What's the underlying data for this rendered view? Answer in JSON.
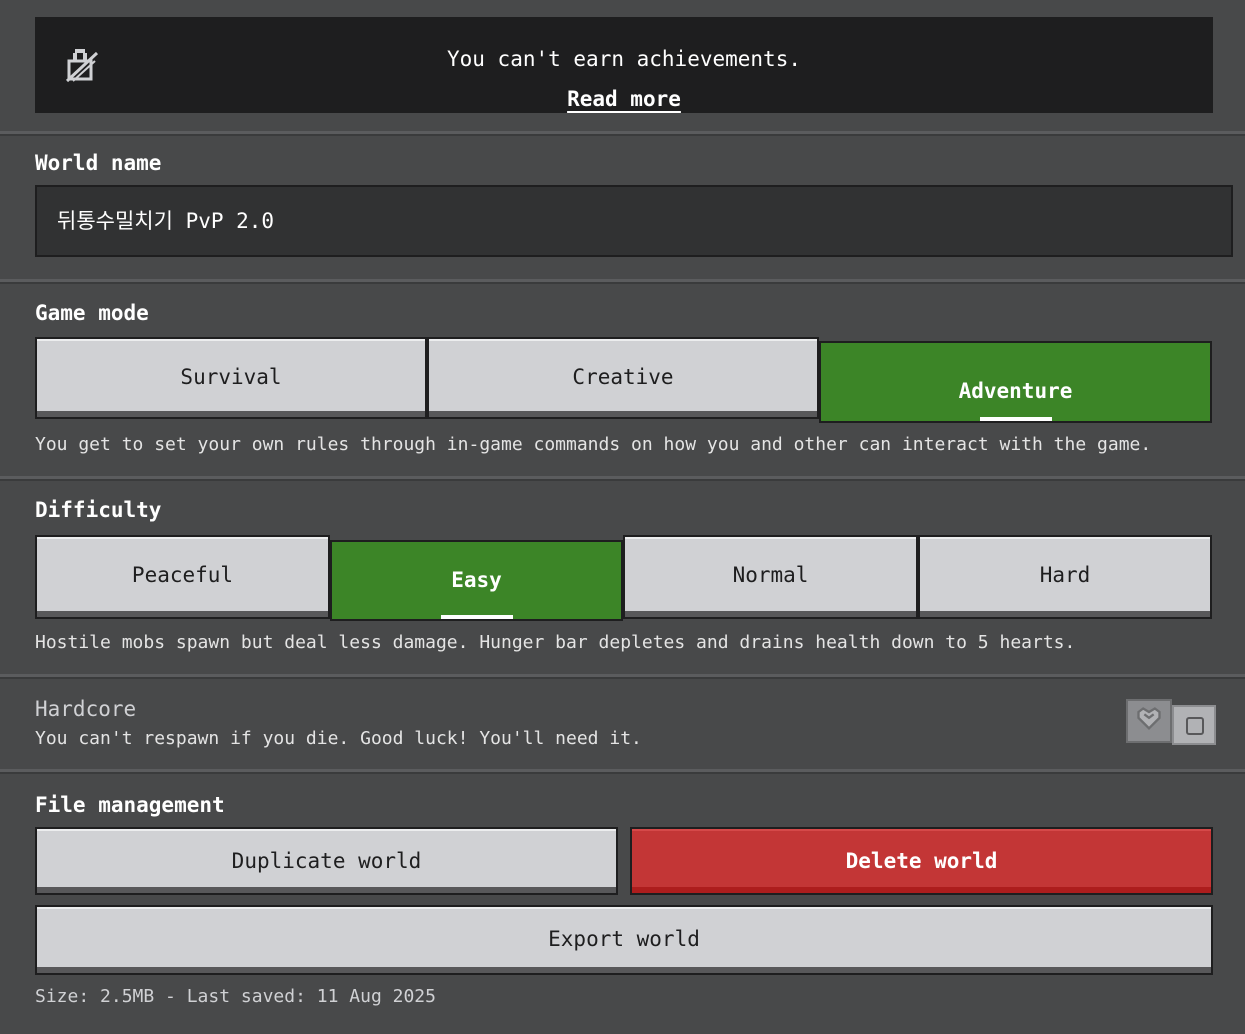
{
  "banner": {
    "message": "You can't earn achievements.",
    "link": "Read more",
    "icon": "lock-icon"
  },
  "world_name": {
    "label": "World name",
    "value": "뒤통수밀치기 PvP 2.0"
  },
  "game_mode": {
    "label": "Game mode",
    "options": [
      "Survival",
      "Creative",
      "Adventure"
    ],
    "selected": "Adventure",
    "description": "You get to set your own rules through in-game commands on how you and other can interact with the game."
  },
  "difficulty": {
    "label": "Difficulty",
    "options": [
      "Peaceful",
      "Easy",
      "Normal",
      "Hard"
    ],
    "selected": "Easy",
    "description": "Hostile mobs spawn but deal less damage. Hunger bar depletes and drains health down to 5 hearts."
  },
  "hardcore": {
    "label": "Hardcore",
    "description": "You can't respawn if you die. Good luck! You'll need it.",
    "enabled": false,
    "icon": "heart-icon"
  },
  "file_management": {
    "label": "File management",
    "duplicate": "Duplicate world",
    "delete": "Delete world",
    "export": "Export world",
    "info": "Size: 2.5MB - Last saved: 11 Aug 2025"
  },
  "colors": {
    "selected_green": "#3c8527",
    "danger_red": "#c33636",
    "button_gray": "#d0d1d4",
    "background": "#48494a"
  }
}
